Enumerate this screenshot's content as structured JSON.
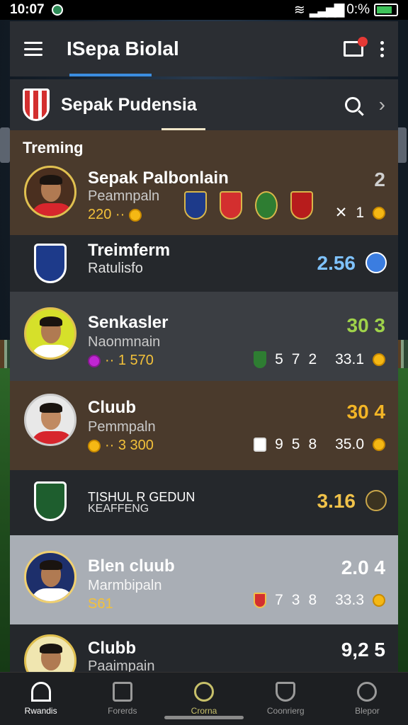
{
  "status_bar": {
    "time": "10:07",
    "battery": "0:%"
  },
  "app_bar": {
    "title": "ISepa Biolal"
  },
  "sub_bar": {
    "name": "Sepak Pudensia"
  },
  "section": {
    "title": "Treming"
  },
  "rows": [
    {
      "name": "Sepak Palbonlain",
      "sub": "Peamnpaln",
      "meta": "220 ·· ",
      "score": "2",
      "stats_value": "1",
      "score_color": "#cfcfcf"
    },
    {
      "name": "Treimferm",
      "sub": "Ratulisfo",
      "score": "2.56",
      "score_color": "#7fc3ff"
    },
    {
      "name": "Senkasler",
      "sub": "Naonmnain",
      "meta": "·· 1 570",
      "score": "30 3",
      "stats": [
        "5",
        "7",
        "2",
        "33.1"
      ],
      "score_color": "#9fd24a"
    },
    {
      "name": "Cluub",
      "sub": "Pemmpaln",
      "meta": "·· 3 300",
      "score": "30 4",
      "stats": [
        "9",
        "5",
        "8",
        "35.0"
      ],
      "score_color": "#f3b526"
    },
    {
      "name": "TISHUL R GEDUN",
      "sub": "KEAFFENG",
      "score": "3.16",
      "score_color": "#f0c24a"
    },
    {
      "name": "Blen cluub",
      "sub": "Marmbipaln",
      "meta": "S61",
      "score": "2.0 4",
      "stats": [
        "7",
        "3",
        "8",
        "33.3"
      ],
      "score_color": "#ffffff"
    },
    {
      "name": "Clubb",
      "sub": "Paaimpain",
      "score": "9,2 5",
      "score_color": "#ffffff"
    }
  ],
  "bottom_nav": [
    {
      "label": "Rwandis",
      "icon": "home-icon",
      "active": true
    },
    {
      "label": "Forerds",
      "icon": "stadium-icon",
      "active": false
    },
    {
      "label": "Crorna",
      "icon": "ball-icon",
      "active": false
    },
    {
      "label": "Coonrierg",
      "icon": "shield-icon",
      "active": false
    },
    {
      "label": "Blepor",
      "icon": "chat-icon",
      "active": false
    }
  ]
}
